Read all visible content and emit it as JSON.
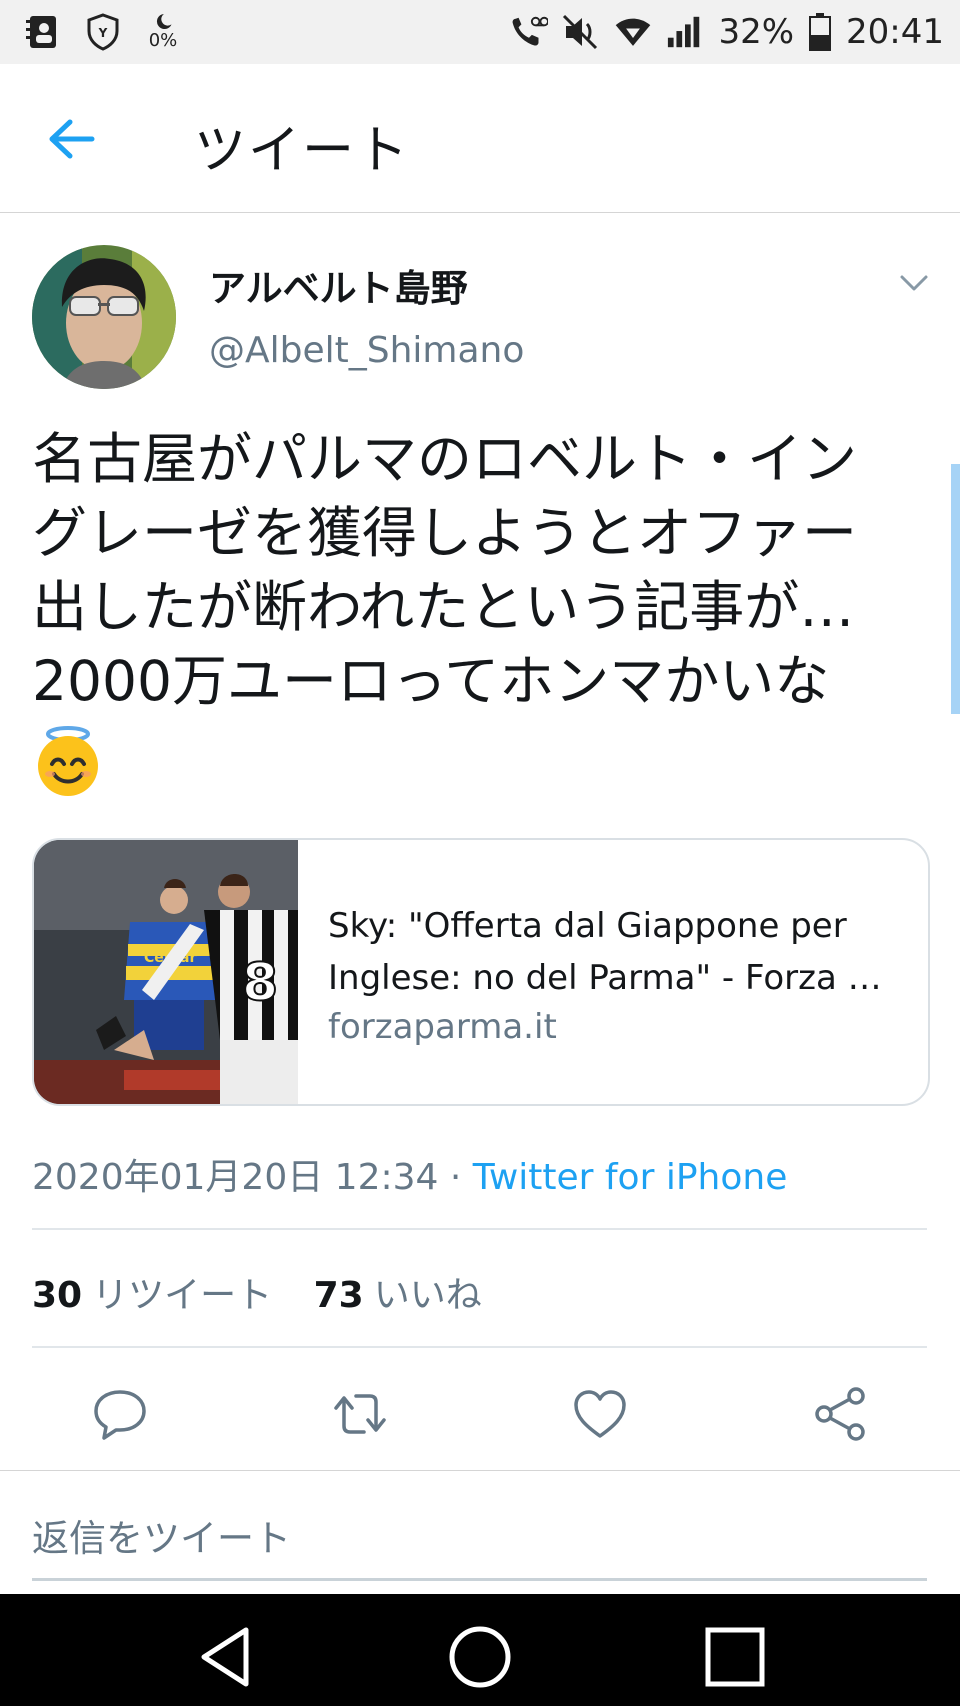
{
  "status_bar": {
    "zero_percent": "0%",
    "battery": "32%",
    "time": "20:41"
  },
  "header": {
    "title": "ツイート"
  },
  "tweet": {
    "author_name": "アルベルト島野",
    "author_handle": "@Albelt_Shimano",
    "text": "名古屋がパルマのロベルト・イン\nグレーゼを獲得しようとオファー\n出したが断われたという記事が…\n2000万ユーロってホンマかいな",
    "card": {
      "title_line1": "Sky: \"Offerta dal Giappone per",
      "title_line2": "Inglese: no del Parma\" - Forza …",
      "domain": "forzaparma.it"
    },
    "timestamp": "2020年01月20日 12:34",
    "separator": " · ",
    "source": "Twitter for iPhone",
    "retweet_count": "30",
    "retweet_label": "リツイート",
    "like_count": "73",
    "like_label": "いいね"
  },
  "reply": {
    "placeholder": "返信をツイート"
  },
  "colors": {
    "accent": "#1da1f2",
    "secondary_text": "#657786"
  },
  "icons": [
    "reply-icon",
    "retweet-icon",
    "like-icon",
    "share-icon",
    "back-arrow-icon",
    "chevron-down-icon"
  ]
}
